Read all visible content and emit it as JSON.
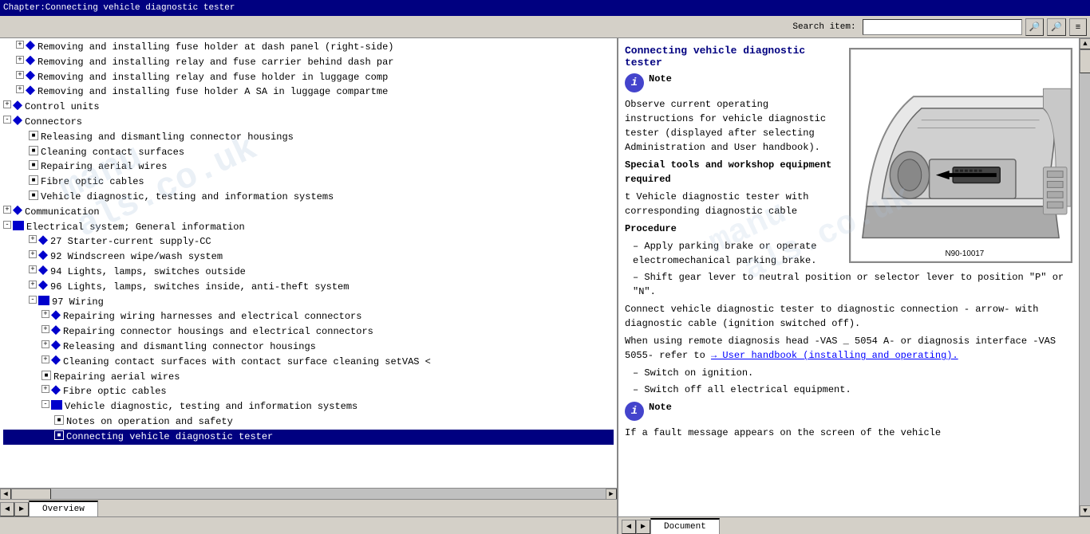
{
  "titlebar": {
    "text": "Chapter:Connecting vehicle diagnostic tester"
  },
  "toolbar": {
    "search_label": "Search item:",
    "search_placeholder": "",
    "btn_search1": "🔍",
    "btn_search2": "🔍",
    "btn_menu": "≡"
  },
  "toc": {
    "items": [
      {
        "id": 1,
        "indent": 1,
        "type": "expand_diamond",
        "text": "Removing and installing fuse holder at dash panel (right-side)",
        "expanded": false
      },
      {
        "id": 2,
        "indent": 1,
        "type": "expand_diamond",
        "text": "Removing and installing relay and fuse carrier behind dash par",
        "expanded": false
      },
      {
        "id": 3,
        "indent": 1,
        "type": "expand_diamond",
        "text": "Removing and installing relay and fuse holder in luggage comp",
        "expanded": false
      },
      {
        "id": 4,
        "indent": 1,
        "type": "expand_diamond",
        "text": "Removing and installing fuse holder A SA in luggage compartme",
        "expanded": false
      },
      {
        "id": 5,
        "indent": 0,
        "type": "expand_diamond",
        "text": "Control units",
        "expanded": false
      },
      {
        "id": 6,
        "indent": 0,
        "type": "expand_diamond",
        "text": "Connectors",
        "expanded": true
      },
      {
        "id": 7,
        "indent": 1,
        "type": "page",
        "text": "Releasing and dismantling connector housings"
      },
      {
        "id": 8,
        "indent": 1,
        "type": "page",
        "text": "Cleaning contact surfaces"
      },
      {
        "id": 9,
        "indent": 1,
        "type": "page",
        "text": "Repairing aerial wires"
      },
      {
        "id": 10,
        "indent": 1,
        "type": "page",
        "text": "Fibre optic cables"
      },
      {
        "id": 11,
        "indent": 1,
        "type": "page",
        "text": "Vehicle diagnostic, testing and information systems"
      },
      {
        "id": 12,
        "indent": 0,
        "type": "expand_diamond",
        "text": "Communication",
        "expanded": false
      },
      {
        "id": 13,
        "indent": 0,
        "type": "book",
        "text": "Electrical system; General information"
      },
      {
        "id": 14,
        "indent": 1,
        "type": "expand_diamond",
        "text": "27 Starter-current supply-CC",
        "expanded": false
      },
      {
        "id": 15,
        "indent": 1,
        "type": "expand_diamond",
        "text": "92 Windscreen wipe/wash system",
        "expanded": false
      },
      {
        "id": 16,
        "indent": 1,
        "type": "expand_diamond",
        "text": "94 Lights, lamps, switches outside",
        "expanded": false
      },
      {
        "id": 17,
        "indent": 1,
        "type": "expand_diamond",
        "text": "96 Lights, lamps, switches inside, anti-theft system",
        "expanded": false
      },
      {
        "id": 18,
        "indent": 1,
        "type": "book_open",
        "text": "97 Wiring",
        "expanded": true
      },
      {
        "id": 19,
        "indent": 2,
        "type": "expand_diamond",
        "text": "Repairing wiring harnesses and electrical connectors",
        "expanded": false
      },
      {
        "id": 20,
        "indent": 2,
        "type": "expand_diamond",
        "text": "Repairing connector housings and electrical connectors",
        "expanded": false
      },
      {
        "id": 21,
        "indent": 2,
        "type": "expand_diamond",
        "text": "Releasing and dismantling connector housings",
        "expanded": false
      },
      {
        "id": 22,
        "indent": 2,
        "type": "expand_diamond",
        "text": "Cleaning contact surfaces with contact surface cleaning setVAS",
        "expanded": false
      },
      {
        "id": 23,
        "indent": 2,
        "type": "page",
        "text": "Repairing aerial wires"
      },
      {
        "id": 24,
        "indent": 2,
        "type": "expand_diamond",
        "text": "Fibre optic cables",
        "expanded": false
      },
      {
        "id": 25,
        "indent": 2,
        "type": "book_open",
        "text": "Vehicle diagnostic, testing and information systems",
        "expanded": true
      },
      {
        "id": 26,
        "indent": 3,
        "type": "page",
        "text": "Notes on operation and safety"
      },
      {
        "id": 27,
        "indent": 3,
        "type": "page_selected",
        "text": "Connecting vehicle diagnostic tester"
      }
    ]
  },
  "content": {
    "title": "Connecting vehicle diagnostic tester",
    "note1_label": "Note",
    "note1_text": "Observe current operating instructions for vehicle diagnostic tester (displayed after selecting Administration and User handbook).",
    "special_tools_label": "Special tools and workshop equipment required",
    "tool_item": "t  Vehicle diagnostic tester with corresponding diagnostic cable",
    "procedure_label": "Procedure",
    "steps": [
      "Apply parking brake or operate electromechanical parking brake.",
      "Shift gear lever to neutral position or selector lever to position \"P\" or \"N\"."
    ],
    "connect_text": "Connect vehicle diagnostic tester to diagnostic connection - arrow- with diagnostic cable (ignition switched off).",
    "remote_text": "When using remote diagnosis head -VAS _ 5054 A- or diagnosis interface -VAS 5055- refer to",
    "link_text": "→ User handbook (installing and operating).",
    "switch_on": "Switch on ignition.",
    "switch_off": "Switch off all electrical equipment.",
    "note2_label": "Note",
    "note2_text": "If a fault message appears on the screen of the vehicle",
    "diagram_label": "N90-10017",
    "arrow_label": "arrow - With diagnostic",
    "watermark": "manu",
    "watermark2": "als.co.uk"
  },
  "tabs": {
    "left": [
      {
        "label": "Overview",
        "active": true
      }
    ],
    "right": [
      {
        "label": "Document",
        "active": true
      }
    ]
  }
}
